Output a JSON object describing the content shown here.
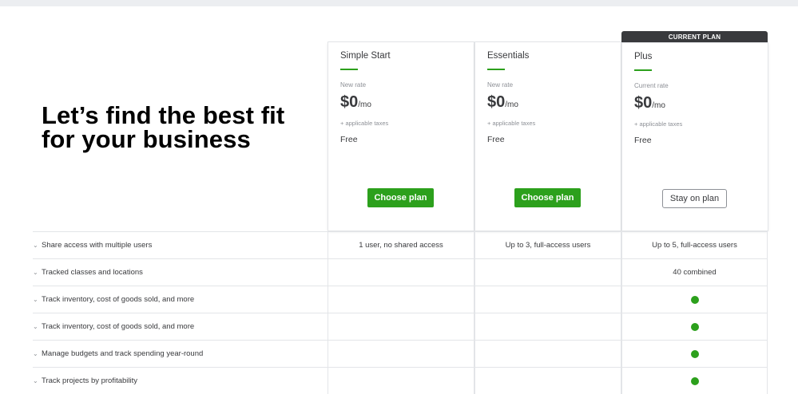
{
  "headline": {
    "line1": "Let’s find the best fit",
    "line2": "for your business"
  },
  "banner": "CURRENT PLAN",
  "plans": [
    {
      "name": "Simple Start",
      "rate_label": "New rate",
      "price": "$0",
      "unit": "/mo",
      "taxes": "+ applicable taxes",
      "tier": "Free",
      "button": "Choose plan"
    },
    {
      "name": "Essentials",
      "rate_label": "New rate",
      "price": "$0",
      "unit": "/mo",
      "taxes": "+ applicable taxes",
      "tier": "Free",
      "button": "Choose plan"
    },
    {
      "name": "Plus",
      "rate_label": "Current rate",
      "price": "$0",
      "unit": "/mo",
      "taxes": "+ applicable taxes",
      "tier": "Free",
      "button": "Stay on plan"
    }
  ],
  "features": [
    {
      "label": "Share access with multiple users",
      "values": [
        "1 user, no shared access",
        "Up to 3, full-access users",
        "Up to 5, full-access users"
      ]
    },
    {
      "label": "Tracked classes and locations",
      "values": [
        "",
        "",
        "40 combined"
      ]
    },
    {
      "label": "Track inventory, cost of goods sold, and more",
      "values": [
        "",
        "",
        ""
      ],
      "included": [
        false,
        false,
        true
      ]
    },
    {
      "label": "Track inventory, cost of goods sold, and more",
      "values": [
        "",
        "",
        ""
      ],
      "included": [
        false,
        false,
        true
      ]
    },
    {
      "label": "Manage budgets and track spending year-round",
      "values": [
        "",
        "",
        ""
      ],
      "included": [
        false,
        false,
        true
      ]
    },
    {
      "label": "Track projects by profitability",
      "values": [
        "",
        "",
        ""
      ],
      "included": [
        false,
        false,
        true
      ]
    }
  ],
  "colors": {
    "accent": "#2ca01c",
    "banner": "#393a3d",
    "text": "#393a3d",
    "muted": "#8d9096"
  },
  "icons": {
    "row_toggle": "chevron-down-icon",
    "included": "check-dot-icon"
  }
}
